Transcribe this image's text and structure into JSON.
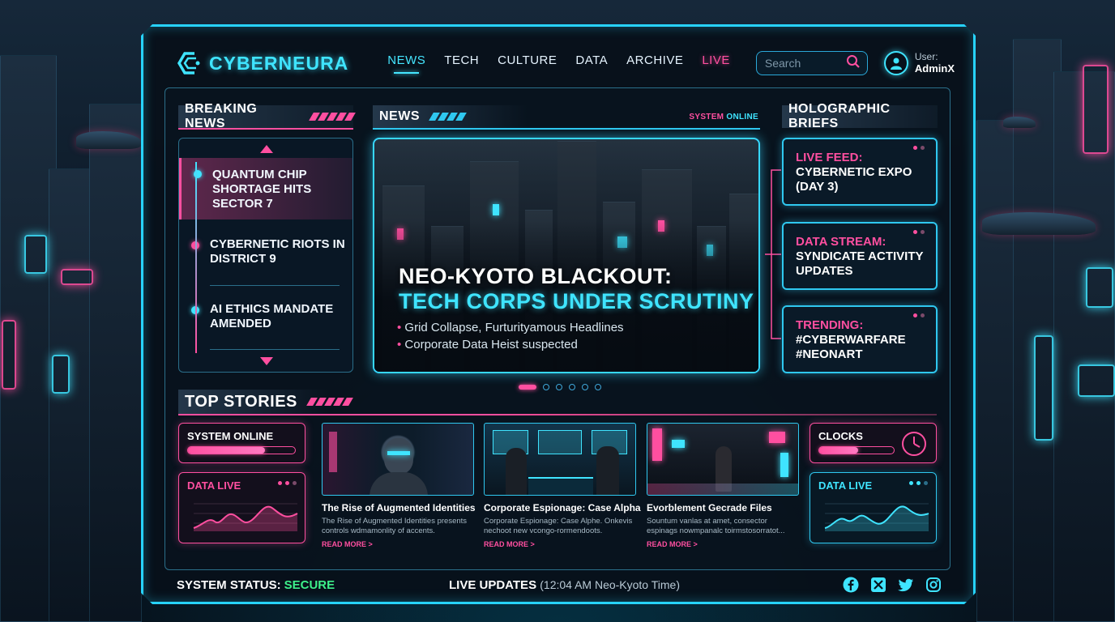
{
  "brand": {
    "name": "CYBERNEURA"
  },
  "nav": {
    "items": [
      {
        "label": "NEWS"
      },
      {
        "label": "TECH"
      },
      {
        "label": "CULTURE"
      },
      {
        "label": "DATA"
      },
      {
        "label": "ARCHIVE"
      },
      {
        "label": "LIVE"
      }
    ]
  },
  "search": {
    "placeholder": "Search"
  },
  "user": {
    "label": "User:",
    "name": "AdminX"
  },
  "breaking": {
    "header": "BREAKING NEWS",
    "items": [
      {
        "text": "QUANTUM CHIP SHORTAGE HITS SECTOR 7"
      },
      {
        "text": "CYBERNETIC RIOTS IN DISTRICT 9"
      },
      {
        "text": "AI ETHICS MANDATE AMENDED"
      }
    ]
  },
  "news": {
    "header": "NEWS",
    "status_prefix": "SYSTEM",
    "status_word": "ONLINE",
    "headline_line1": "NEO-KYOTO BLACKOUT:",
    "headline_line2": "TECH CORPS UNDER SCRUTINY",
    "bullets": [
      "Grid Collapse, Furturityamous Headlines",
      "Corporate Data Heist suspected"
    ],
    "carousel": {
      "count": 6,
      "active": 1
    }
  },
  "briefs": {
    "header": "HOLOGRAPHIC BRIEFS",
    "items": [
      {
        "title": "LIVE FEED:",
        "text": "CYBERNETIC EXPO (DAY 3)"
      },
      {
        "title": "DATA STREAM:",
        "text": "SYNDICATE ACTIVITY UPDATES"
      },
      {
        "title": "TRENDING:",
        "text": "#CYBERWARFARE #NEONART"
      }
    ]
  },
  "top_stories": {
    "header": "TOP STORIES",
    "system_online": {
      "label": "SYSTEM ONLINE",
      "progress": 0.72
    },
    "data_live_left": {
      "label": "DATA LIVE"
    },
    "clocks": {
      "label": "CLOCKS",
      "progress": 0.52
    },
    "data_live_right": {
      "label": "DATA LIVE"
    },
    "stories": [
      {
        "title": "The Rise of Augmented Identities",
        "desc": "The Rise of Augmented Identities presents controls wdmamonlity of accents.",
        "more": "READ MORE >"
      },
      {
        "title": "Corporate Espionage: Case Alpha",
        "desc": "Corporate Espionage: Case Alphe. Onkevis nechoot new vcongo-rormendoots.",
        "more": "READ MORE >"
      },
      {
        "title": "Evorblement Gecrade Files",
        "desc": "Sountum vanlas at amet, consector espinags nowmpanalc toirmstosorratot...",
        "more": "READ MORE >"
      }
    ]
  },
  "footer": {
    "status_label": "SYSTEM STATUS:",
    "status_value": "SECURE",
    "live_label": "LIVE UPDATES",
    "live_time": "(12:04 AM Neo-Kyoto Time)"
  },
  "colors": {
    "accent_cyan": "#3fe4ff",
    "accent_pink": "#ff4fa0",
    "secure_green": "#3df08a"
  }
}
